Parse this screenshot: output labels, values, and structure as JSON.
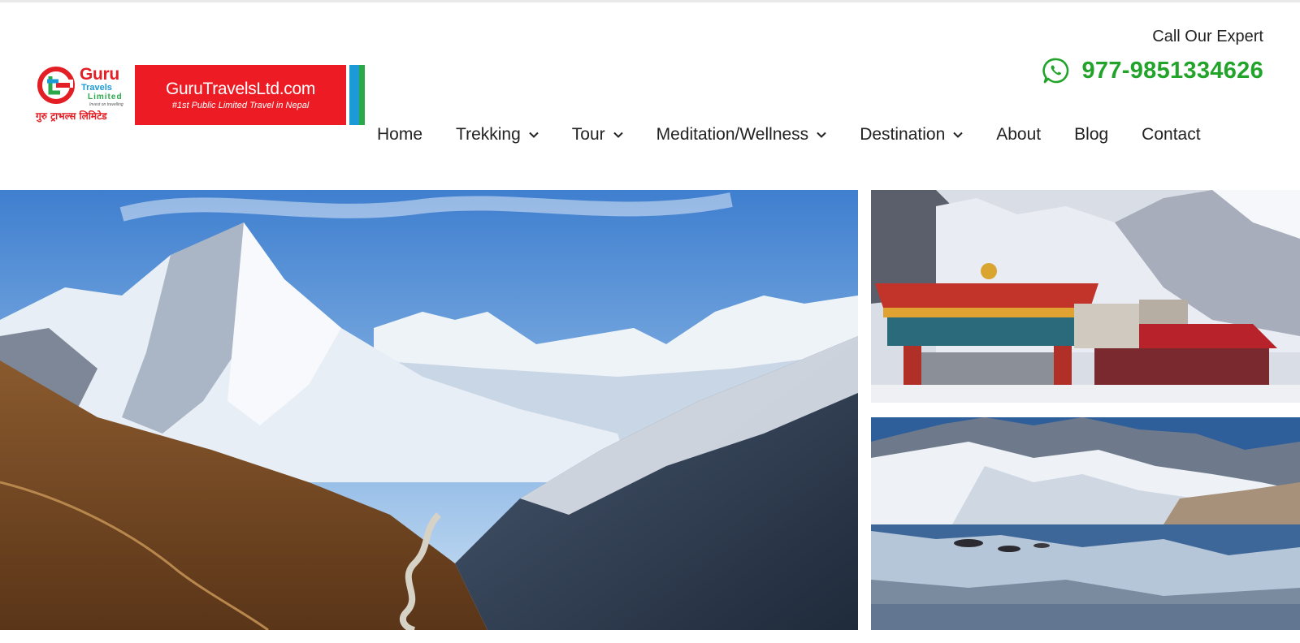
{
  "header": {
    "logo": {
      "brand": "Guru",
      "travels": "Travels",
      "limited": "Limited",
      "tagline": "Invest on travelling",
      "devanagari": "गुरु ट्राभल्स लिमिटेड",
      "site": "GuruTravelsLtd.com",
      "subtitle": "#1st Public Limited Travel in Nepal"
    },
    "call_label": "Call Our Expert",
    "phone": "977-9851334626",
    "phone_icon": "whatsapp-icon"
  },
  "nav": {
    "items": [
      {
        "label": "Home",
        "has_dropdown": false
      },
      {
        "label": "Trekking",
        "has_dropdown": true
      },
      {
        "label": "Tour",
        "has_dropdown": true
      },
      {
        "label": "Meditation/Wellness",
        "has_dropdown": true
      },
      {
        "label": "Destination",
        "has_dropdown": true
      },
      {
        "label": "About",
        "has_dropdown": false
      },
      {
        "label": "Blog",
        "has_dropdown": false
      },
      {
        "label": "Contact",
        "has_dropdown": false
      }
    ]
  },
  "hero": {
    "images": [
      {
        "name": "himalayan-valley-photo"
      },
      {
        "name": "monastery-photo"
      },
      {
        "name": "mountain-lake-photo"
      }
    ]
  },
  "colors": {
    "accent_green": "#22a32a",
    "logo_red": "#ed1c24",
    "stripe_blue": "#1c9ad6",
    "stripe_green": "#2aa84a",
    "text": "#222222"
  }
}
